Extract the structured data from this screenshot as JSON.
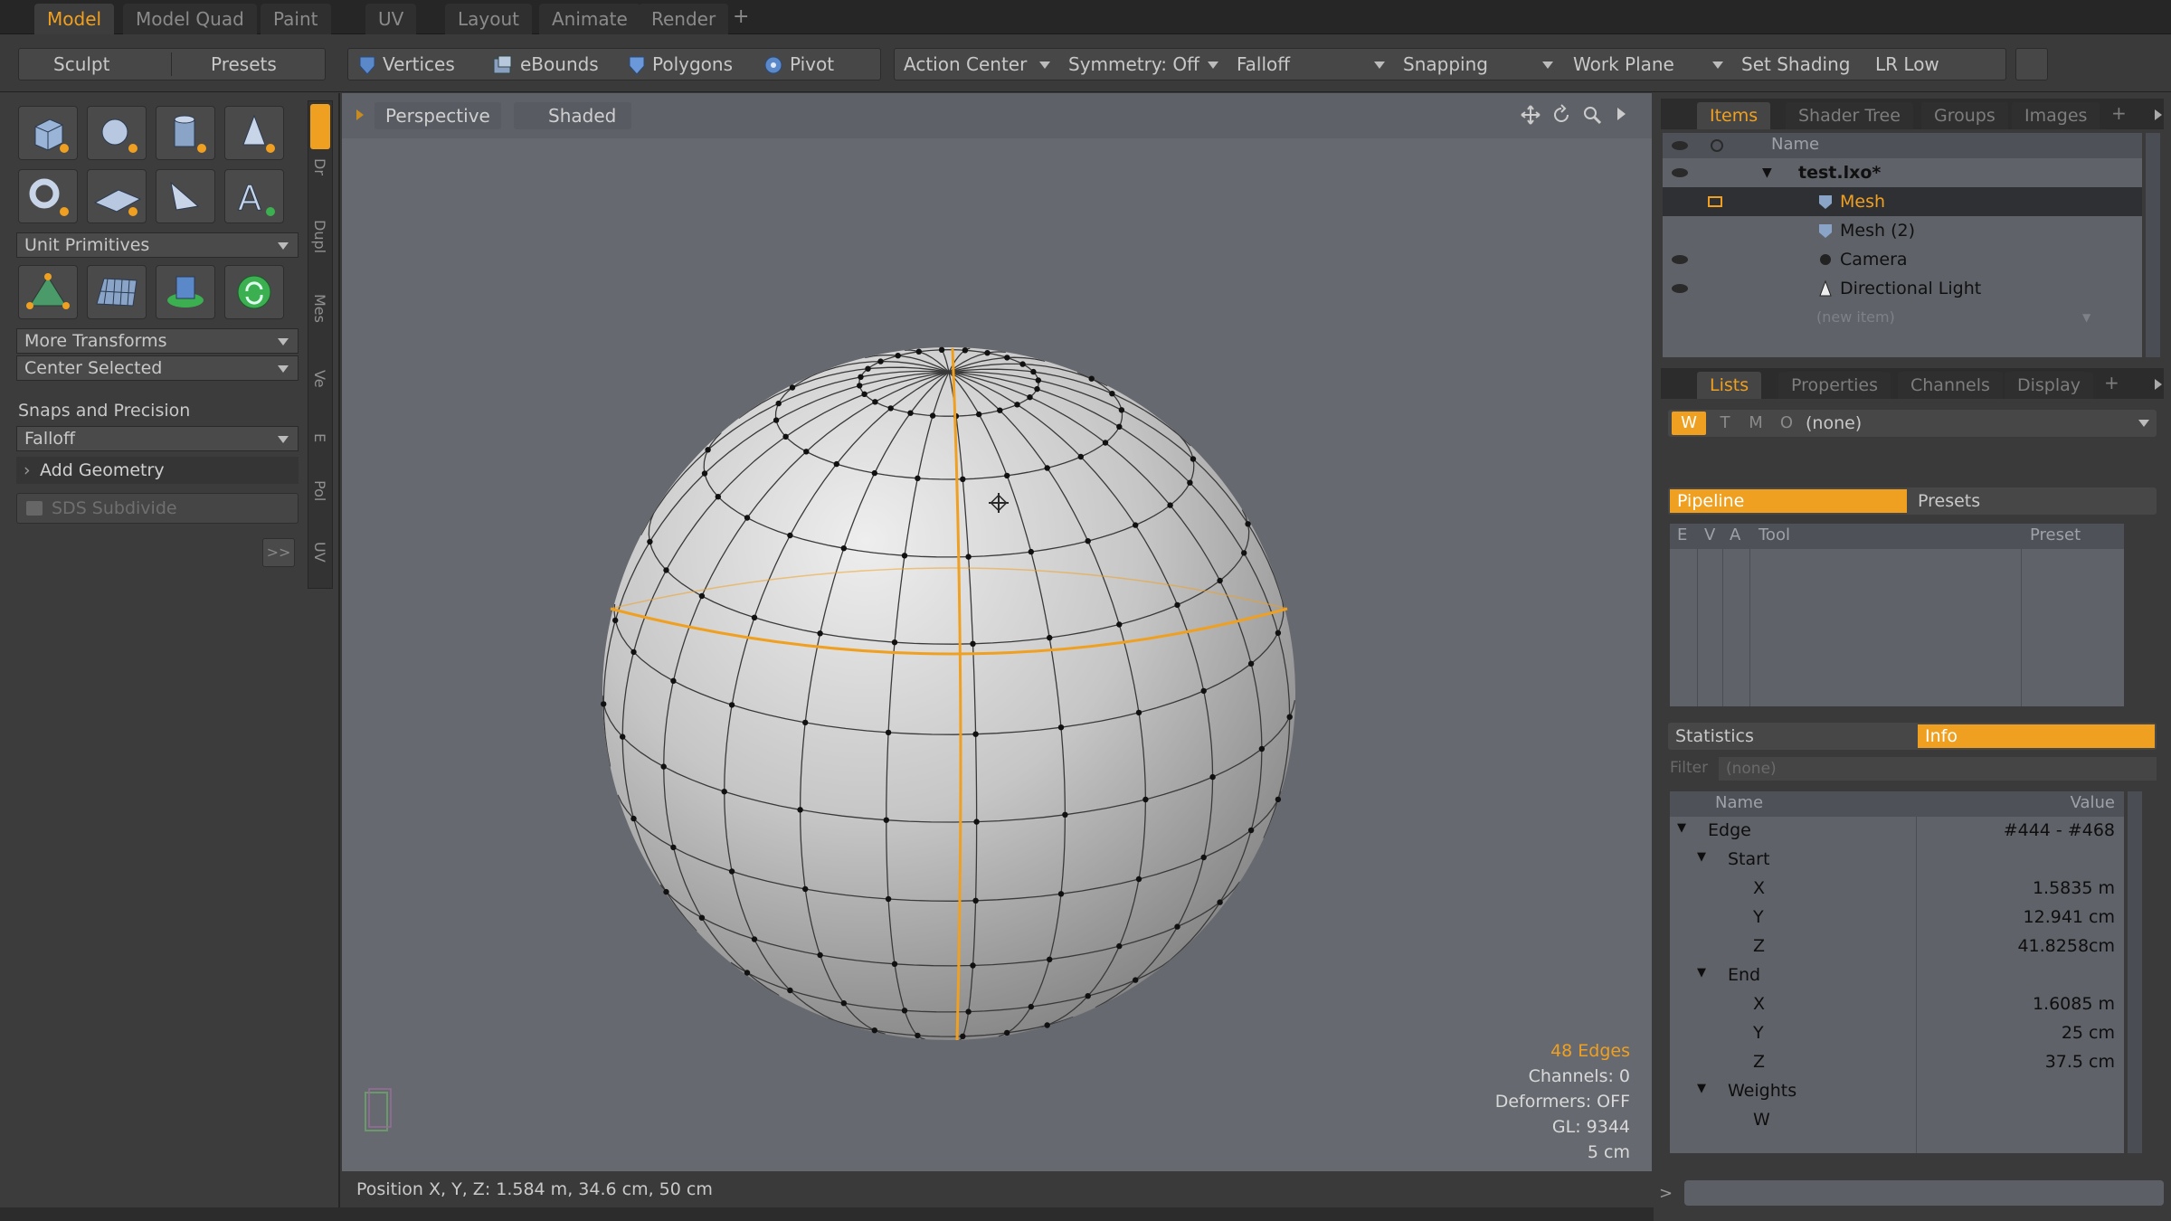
{
  "top_tabs": [
    "Model",
    "Model Quad",
    "Paint",
    "UV",
    "Layout",
    "Animate",
    "Render"
  ],
  "top_tab_add": "+",
  "toolbar": {
    "sculpt": "Sculpt",
    "presets": "Presets",
    "vertices": "Vertices",
    "ebounds": "eBounds",
    "polygons": "Polygons",
    "pivot": "Pivot",
    "action_center": "Action Center",
    "symmetry": "Symmetry: Off",
    "falloff": "Falloff",
    "snapping": "Snapping",
    "work_plane": "Work Plane",
    "set_shading": "Set Shading",
    "lr_low": "LR Low"
  },
  "left": {
    "unit_primitives": "Unit Primitives",
    "more_transforms": "More Transforms",
    "center_selected": "Center Selected",
    "snaps_precision": "Snaps and Precision",
    "falloff": "Falloff",
    "add_geometry": "Add Geometry",
    "sds_subdivide": "SDS Subdivide",
    "expand": ">>",
    "vertical_tabs": [
      "Dr",
      "Dupl",
      "Mes",
      "Ve",
      "E",
      "Pol",
      "UV"
    ]
  },
  "viewport": {
    "view": "Perspective",
    "shading": "Shaded",
    "info": [
      "48 Edges",
      "Channels: 0",
      "Deformers: OFF",
      "GL: 9344",
      "5 cm"
    ],
    "status": "Position X, Y, Z:  1.584 m, 34.6 cm, 50 cm"
  },
  "items": {
    "tabs": [
      "Items",
      "Shader Tree",
      "Groups",
      "Images"
    ],
    "header": "Name",
    "rows": [
      {
        "label": "test.lxo*"
      },
      {
        "label": "Mesh"
      },
      {
        "label": "Mesh (2)"
      },
      {
        "label": "Camera"
      },
      {
        "label": "Directional Light"
      },
      {
        "label": "(new item)"
      }
    ]
  },
  "lists": {
    "tabs": [
      "Lists",
      "Properties",
      "Channels",
      "Display"
    ],
    "wtmo": [
      "W",
      "T",
      "M",
      "O"
    ],
    "none": "(none)",
    "pipeline": "Pipeline",
    "presets": "Presets",
    "cols": [
      "E",
      "V",
      "A",
      "Tool",
      "Preset"
    ]
  },
  "stats": {
    "statistics": "Statistics",
    "info": "Info",
    "filter_label": "Filter",
    "filter_value": "(none)",
    "name_col": "Name",
    "value_col": "Value",
    "rows": [
      {
        "label": "Edge",
        "value": "#444 - #468"
      },
      {
        "label": "Start",
        "value": ""
      },
      {
        "label": "X",
        "value": "1.5835 m"
      },
      {
        "label": "Y",
        "value": "12.941 cm"
      },
      {
        "label": "Z",
        "value": "41.8258cm"
      },
      {
        "label": "End",
        "value": ""
      },
      {
        "label": "X",
        "value": "1.6085 m"
      },
      {
        "label": "Y",
        "value": "25 cm"
      },
      {
        "label": "Z",
        "value": "37.5 cm"
      },
      {
        "label": "Weights",
        "value": ""
      },
      {
        "label": "W",
        "value": ""
      }
    ]
  },
  "colors": {
    "accent": "#f0a020",
    "viewport_bg": "#666a70"
  }
}
